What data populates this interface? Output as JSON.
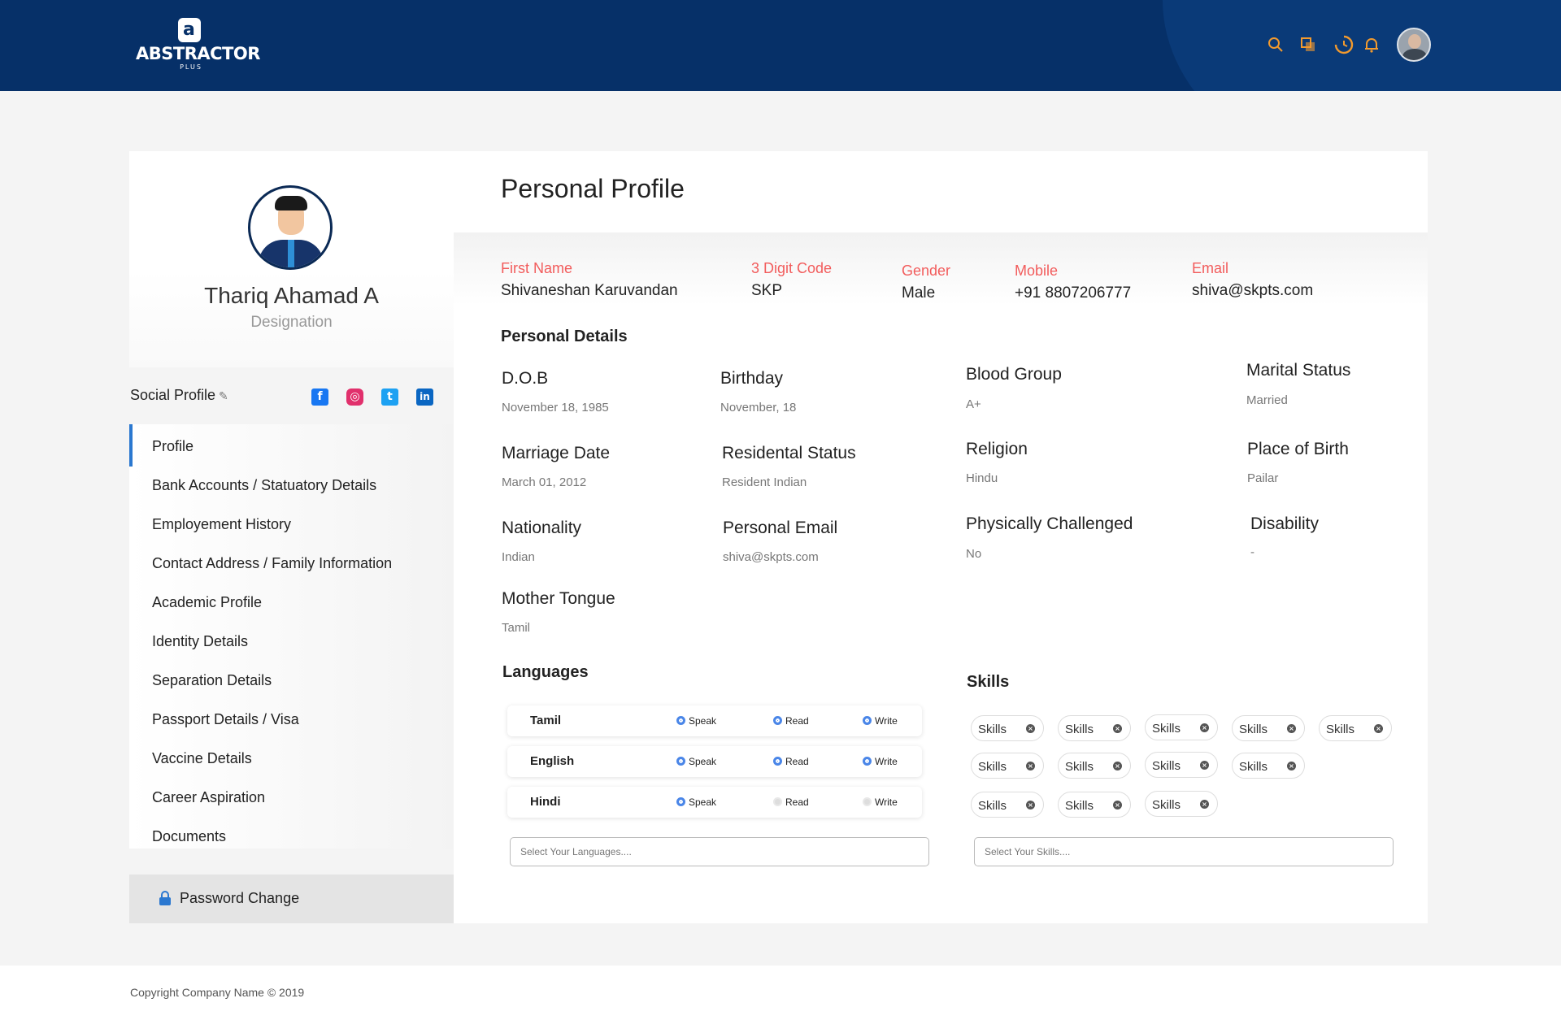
{
  "app": {
    "logo_text": "ABSTRACTOR",
    "logo_sub": "PLUS",
    "logo_mark": "a"
  },
  "header": {
    "icons": [
      "search-icon",
      "copy-icon",
      "clock-history-icon",
      "bell-icon"
    ],
    "icon_color": "#f29a2e",
    "bg_color": "#063068"
  },
  "profile": {
    "name": "Thariq Ahamad A",
    "designation": "Designation"
  },
  "social": {
    "label": "Social Profile",
    "icons": [
      {
        "name": "facebook-icon",
        "glyph": "f",
        "color": "#1877f2"
      },
      {
        "name": "instagram-icon",
        "glyph": "◎",
        "color": "#e1306c"
      },
      {
        "name": "twitter-icon",
        "glyph": "t",
        "color": "#1da1f2"
      },
      {
        "name": "linkedin-icon",
        "glyph": "in",
        "color": "#0a66c2"
      }
    ]
  },
  "nav": {
    "active_color": "#2b78d0",
    "items": [
      "Profile",
      "Bank Accounts / Statuatory Details",
      "Employement History",
      "Contact Address / Family Information",
      "Academic Profile",
      "Identity Details",
      "Separation Details",
      "Passport Details / Visa",
      "Vaccine Details",
      "Career Aspiration",
      "Documents"
    ],
    "password_change": "Password Change"
  },
  "main": {
    "title": "Personal Profile",
    "summary": [
      {
        "label": "First Name",
        "value": "Shivaneshan Karuvandan"
      },
      {
        "label": "3 Digit Code",
        "value": "SKP"
      },
      {
        "label": "Gender",
        "value": "Male"
      },
      {
        "label": "Mobile",
        "value": "+91 8807206777"
      },
      {
        "label": "Email",
        "value": "shiva@skpts.com"
      }
    ],
    "personal_details_title": "Personal Details",
    "fields": [
      {
        "label": "D.O.B",
        "value": "November 18, 1985"
      },
      {
        "label": "Birthday",
        "value": "November, 18"
      },
      {
        "label": "Blood Group",
        "value": "A+"
      },
      {
        "label": "Marital Status",
        "value": "Married"
      },
      {
        "label": "Marriage Date",
        "value": "March 01, 2012"
      },
      {
        "label": "Residental Status",
        "value": "Resident Indian"
      },
      {
        "label": "Religion",
        "value": "Hindu"
      },
      {
        "label": "Place of Birth",
        "value": "Pailar"
      },
      {
        "label": "Nationality",
        "value": "Indian"
      },
      {
        "label": "Personal Email",
        "value": "shiva@skpts.com"
      },
      {
        "label": "Physically Challenged",
        "value": "No"
      },
      {
        "label": "Disability",
        "value": "-"
      },
      {
        "label": "Mother Tongue",
        "value": "Tamil"
      }
    ],
    "languages_title": "Languages",
    "option_labels": {
      "speak": "Speak",
      "read": "Read",
      "write": "Write"
    },
    "languages": [
      {
        "name": "Tamil",
        "speak": true,
        "read": true,
        "write": true
      },
      {
        "name": "English",
        "speak": true,
        "read": true,
        "write": true
      },
      {
        "name": "Hindi",
        "speak": true,
        "read": false,
        "write": false
      }
    ],
    "languages_placeholder": "Select Your Languages....",
    "skills_title": "Skills",
    "skills": [
      "Skills",
      "Skills",
      "Skills",
      "Skills",
      "Skills",
      "Skills",
      "Skills",
      "Skills",
      "Skills",
      "Skills",
      "Skills",
      "Skills"
    ],
    "skills_placeholder": "Select Your Skills....",
    "label_color": "#f25c5c"
  },
  "footer": {
    "copyright": "Copyright Company Name © 2019"
  }
}
